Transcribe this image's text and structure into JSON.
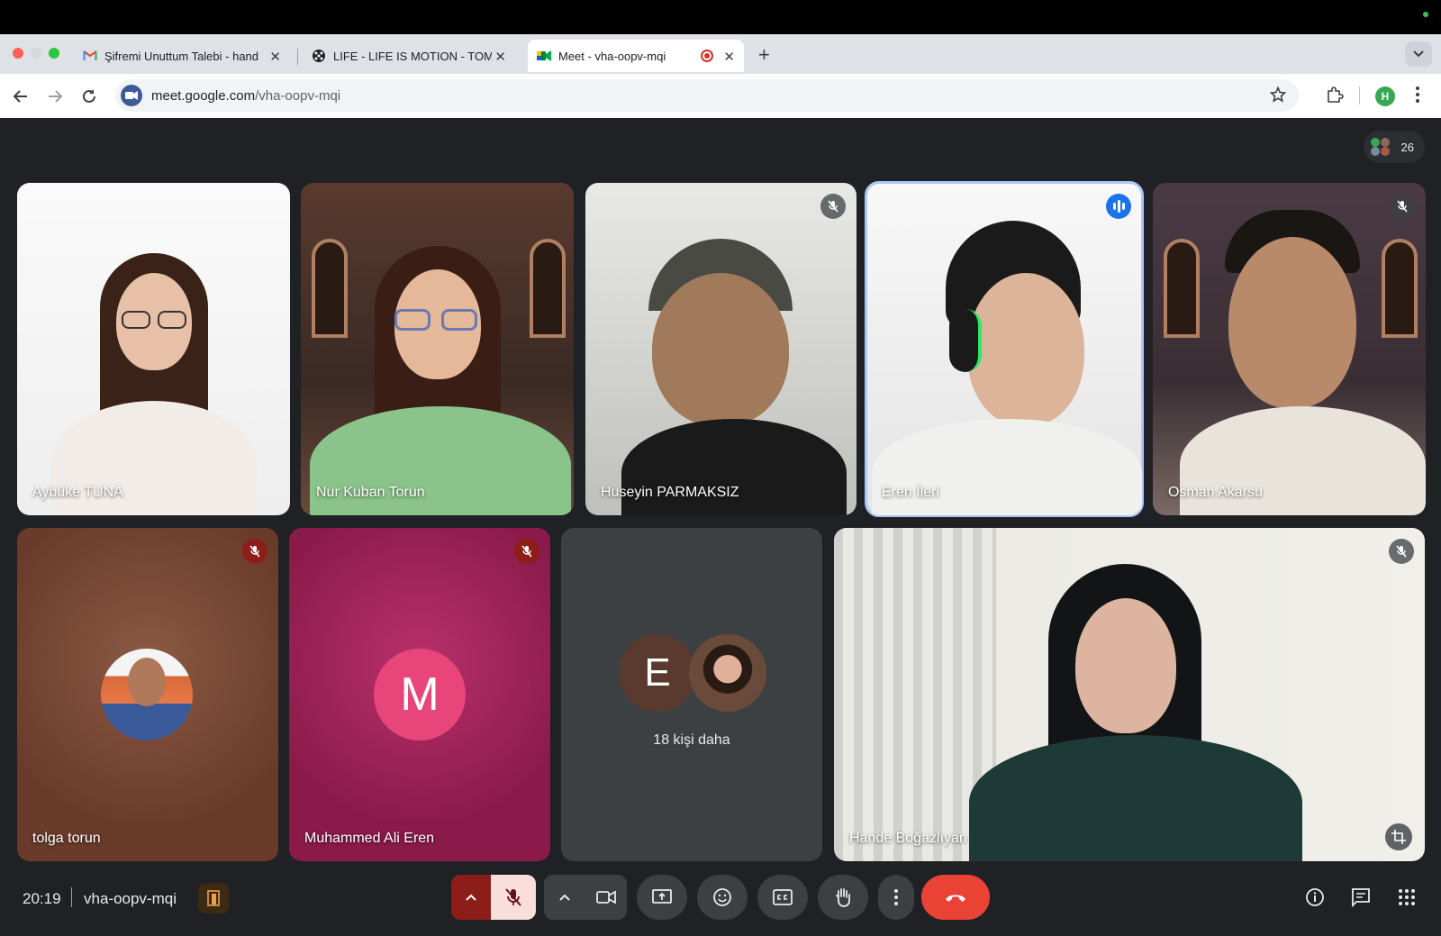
{
  "browser": {
    "tabs": [
      {
        "title": "Şifremi Unuttum Talebi - hand",
        "active": false
      },
      {
        "title": "LIFE - LIFE IS MOTION - TOM",
        "active": false
      },
      {
        "title": "Meet - vha-oopv-mqi",
        "active": true
      }
    ],
    "url_host": "meet.google.com",
    "url_path": "/vha-oopv-mqi",
    "profile_initial": "H"
  },
  "meet": {
    "participant_count": "26",
    "tiles": [
      {
        "name": "Aybüke TUNA"
      },
      {
        "name": "Nur Kuban Torun"
      },
      {
        "name": "Huseyin PARMAKSIZ",
        "muted": true
      },
      {
        "name": "Eren İleri",
        "speaking": true
      },
      {
        "name": "Osman Akarsu",
        "muted": true
      },
      {
        "name": "tolga torun",
        "muted": true
      },
      {
        "name": "Muhammed Ali Eren",
        "muted": true,
        "initial": "M"
      },
      {
        "name": "Hande Boğazlıyan",
        "muted": true
      }
    ],
    "overflow": {
      "initial": "E",
      "label": "18 kişi daha"
    },
    "time": "20:19",
    "meeting_code": "vha-oopv-mqi"
  },
  "colors": {
    "accent": "#1a73e8",
    "end_call": "#ea4335",
    "meet_bg": "#202124"
  }
}
